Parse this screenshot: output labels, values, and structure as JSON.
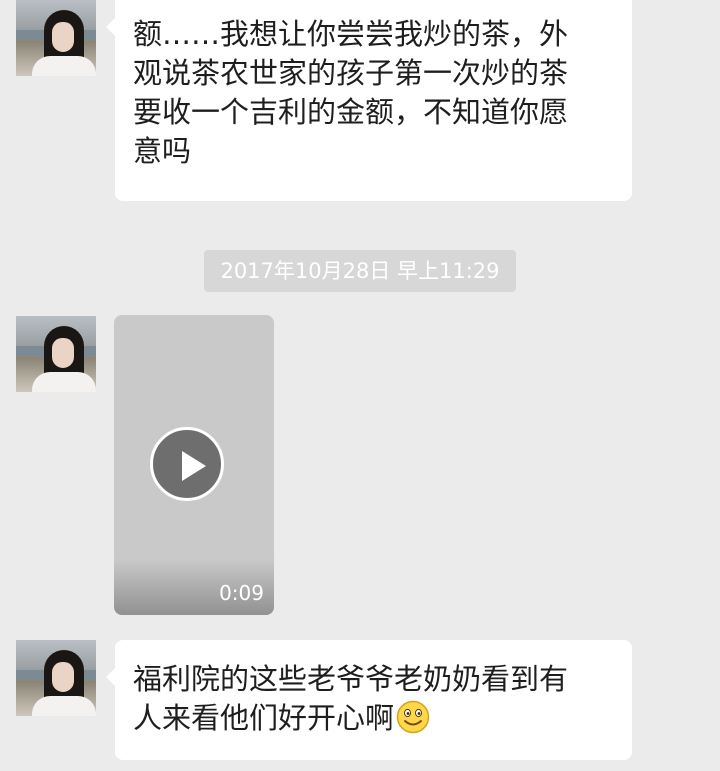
{
  "messages": [
    {
      "lines": [
        "额……我想让你尝尝我炒的茶，外",
        "观说茶农世家的孩子第一次炒的茶",
        "要收一个吉利的金额，不知道你愿",
        "意吗"
      ]
    },
    {
      "timestamp": "2017年10月28日 早上11:29"
    },
    {
      "video": {
        "duration": "0:09"
      }
    },
    {
      "lines": [
        "福利院的这些老爷爷老奶奶看到有",
        "人来看他们好开心啊"
      ],
      "emoji": "smile-emoji"
    }
  ],
  "colors": {
    "background": "#ebebeb",
    "bubble": "#ffffff",
    "timestamp_bg": "#d7d7d7",
    "video_bg": "#c9c9c9"
  }
}
